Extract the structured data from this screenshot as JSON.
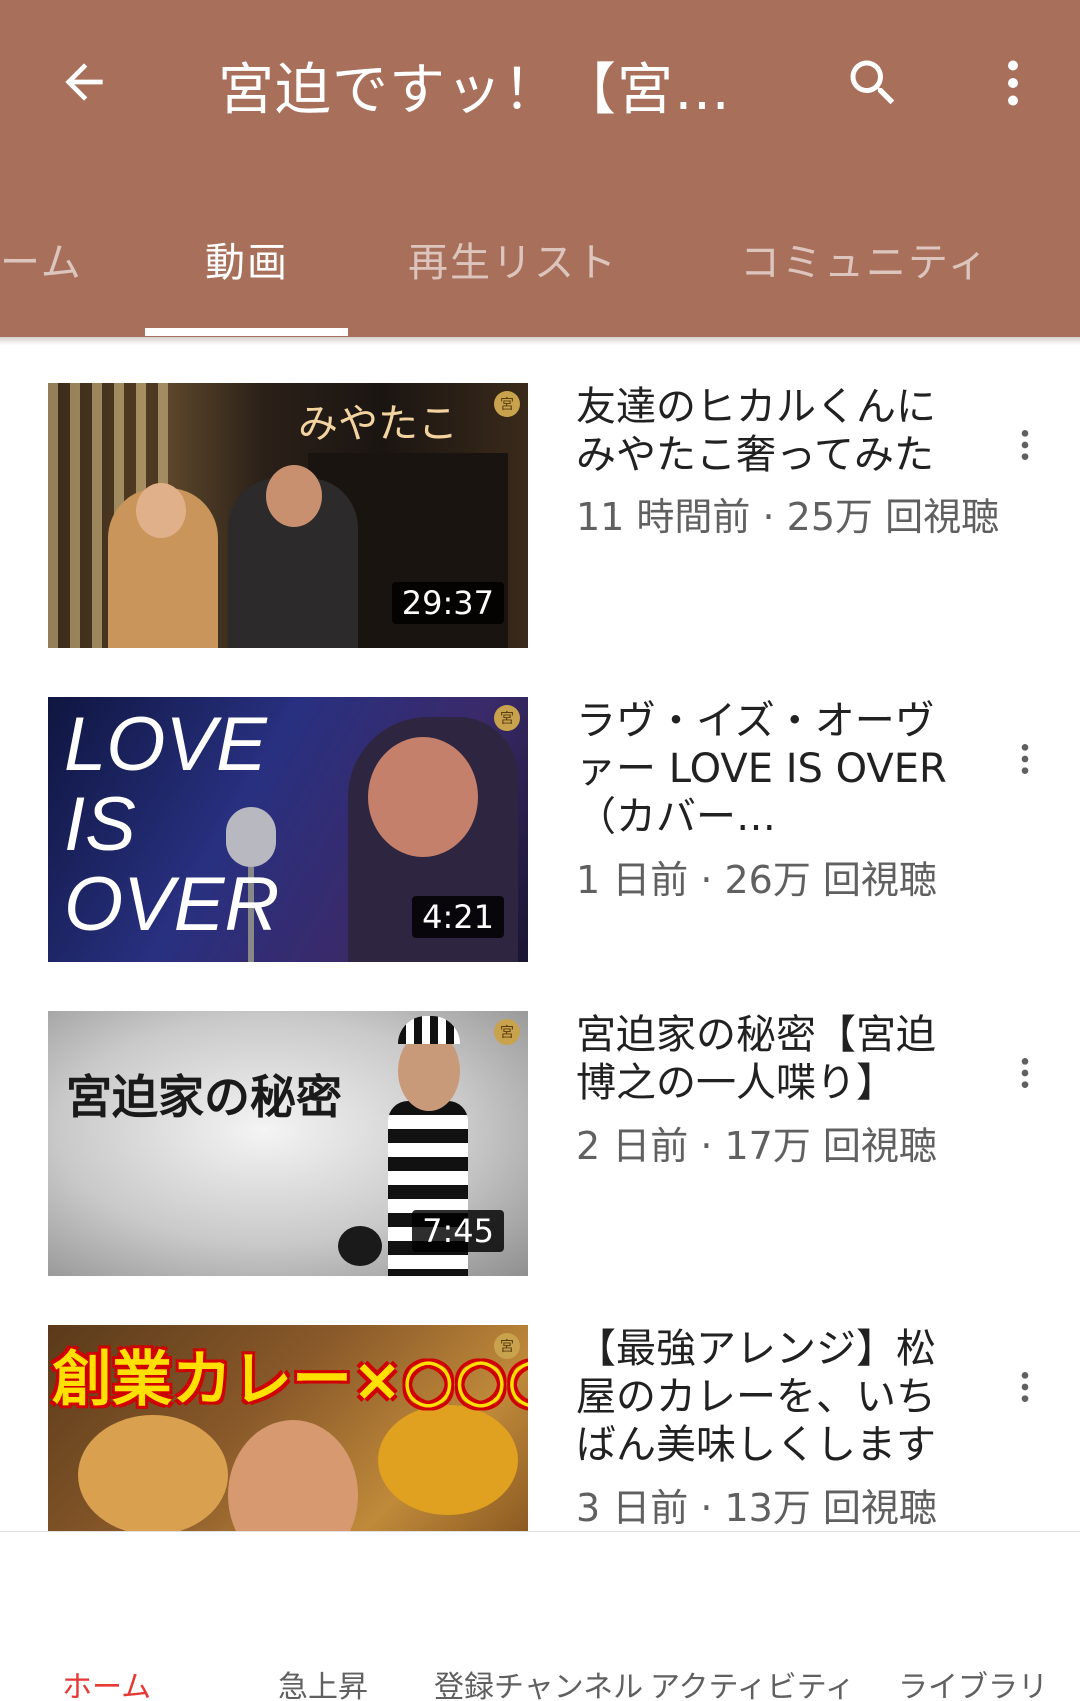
{
  "header": {
    "title": "宮迫ですッ！【宮迫…",
    "background_color": "#a86f5b"
  },
  "tabs": [
    {
      "label": "ーム",
      "active": false
    },
    {
      "label": "動画",
      "active": true
    },
    {
      "label": "再生リスト",
      "active": false
    },
    {
      "label": "コミュニティ",
      "active": false
    }
  ],
  "videos": [
    {
      "title": "友達のヒカルくんにみやたこ奢ってみた",
      "meta": "11 時間前 · 25万 回視聴",
      "duration": "29:37",
      "thumb_text": "みやたこ"
    },
    {
      "title": "ラヴ・イズ・オーヴァー LOVE IS OVER（カバー…",
      "meta": "1 日前 · 26万 回視聴",
      "duration": "4:21",
      "thumb_text": "LOVE IS OVER"
    },
    {
      "title": "宮迫家の秘密【宮迫博之の一人喋り】",
      "meta": "2 日前 · 17万 回視聴",
      "duration": "7:45",
      "thumb_text": "宮迫家の秘密"
    },
    {
      "title": "【最強アレンジ】松屋のカレーを、いちばん美味しくします",
      "meta": "3 日前 · 13万 回視聴",
      "duration": "",
      "thumb_text": "創業カレー×○○○"
    }
  ],
  "badge_char": "宮",
  "bottom_nav": [
    {
      "label": "ホーム",
      "active": true
    },
    {
      "label": "急上昇",
      "active": false
    },
    {
      "label": "登録チャンネル",
      "active": false
    },
    {
      "label": "アクティビティ",
      "active": false
    },
    {
      "label": "ライブラリ",
      "active": false
    }
  ],
  "colors": {
    "accent_red": "#e53935",
    "header": "#a86f5b"
  }
}
